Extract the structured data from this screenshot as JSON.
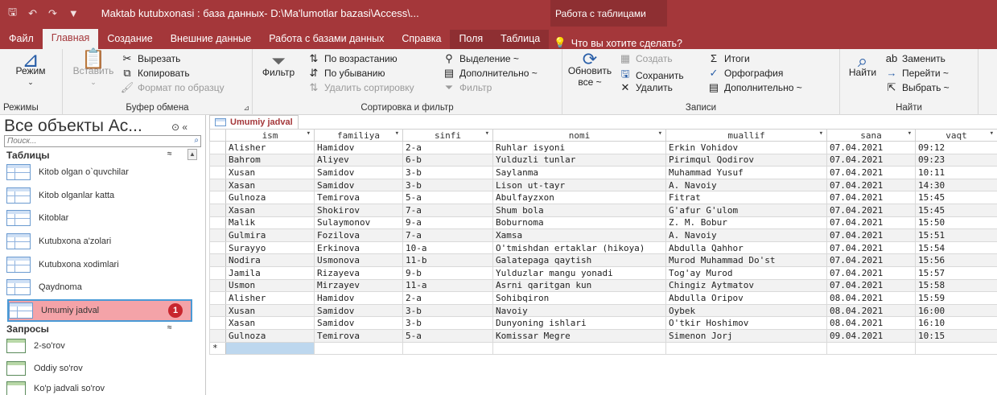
{
  "titlebar": {
    "quick_access": [
      "🖫",
      "↶",
      "↷",
      "▼"
    ],
    "title": "Maktab kutubxonasi : база данных- D:\\Ma'lumotlar bazasi\\Access\\...",
    "context_title": "Работа с таблицами"
  },
  "menubar": {
    "tabs": [
      "Файл",
      "Главная",
      "Создание",
      "Внешние данные",
      "Работа с базами данных",
      "Справка",
      "Поля",
      "Таблица"
    ],
    "tell_me": "Что вы хотите сделать?"
  },
  "ribbon": {
    "modes": {
      "button": "Режим",
      "label": "Режимы"
    },
    "clipboard": {
      "paste": "Вставить",
      "cut": "Вырезать",
      "copy": "Копировать",
      "format_painter": "Формат по образцу",
      "label": "Буфер обмена"
    },
    "sort": {
      "filter": "Фильтр",
      "ascending": "По возрастанию",
      "descending": "По убыванию",
      "remove_sort": "Удалить сортировку",
      "selection": "Выделение ~",
      "advanced": "Дополнительно ~",
      "toggle_filter": "Фильтр",
      "label": "Сортировка и фильтр"
    },
    "records": {
      "refresh": "Обновить все ~",
      "new": "Создать",
      "save": "Сохранить",
      "delete": "Удалить",
      "totals": "Итоги",
      "spelling": "Орфография",
      "more": "Дополнительно ~",
      "label": "Записи"
    },
    "find": {
      "find": "Найти",
      "replace": "Заменить",
      "goto": "Перейти ~",
      "select": "Выбрать ~",
      "label": "Найти"
    }
  },
  "nav": {
    "title": "Все объекты Ac...",
    "search_placeholder": "Поиск...",
    "tables_header": "Таблицы",
    "tables": [
      "Kitob olgan o`quvchilar",
      "Kitob olganlar katta",
      "Kitoblar",
      "Kutubxona a'zolari",
      "Kutubxona xodimlari",
      "Qaydnoma",
      "Umumiy jadval"
    ],
    "selected_badge": "1",
    "queries_header": "Запросы",
    "queries": [
      "2-so'rov",
      "Oddiy so'rov",
      "Ko'p jadvali so'rov"
    ]
  },
  "datasheet": {
    "tab_label": "Umumiy jadval",
    "columns": [
      "ism",
      "familiya",
      "sinfi",
      "nomi",
      "muallif",
      "sana",
      "vaqt"
    ],
    "rows": [
      [
        "Alisher",
        "Hamidov",
        "2-a",
        "Ruhlar isyoni",
        "Erkin Vohidov",
        "07.04.2021",
        "09:12"
      ],
      [
        "Bahrom",
        "Aliyev",
        "6-b",
        "Yulduzli tunlar",
        "Pirimqul Qodirov",
        "07.04.2021",
        "09:23"
      ],
      [
        "Xusan",
        "Samidov",
        "3-b",
        "Saylanma",
        "Muhammad Yusuf",
        "07.04.2021",
        "10:11"
      ],
      [
        "Xasan",
        "Samidov",
        "3-b",
        "Lison ut-tayr",
        "A. Navoiy",
        "07.04.2021",
        "14:30"
      ],
      [
        "Gulnoza",
        "Temirova",
        "5-a",
        "Abulfayzxon",
        "Fitrat",
        "07.04.2021",
        "15:45"
      ],
      [
        "Xasan",
        "Shokirov",
        "7-a",
        "Shum bola",
        "G'afur G'ulom",
        "07.04.2021",
        "15:45"
      ],
      [
        "Malik",
        "Sulaymonov",
        "9-a",
        "Boburnoma",
        "Z. M. Bobur",
        "07.04.2021",
        "15:50"
      ],
      [
        "Gulmira",
        "Fozilova",
        "7-a",
        "Xamsa",
        "A. Navoiy",
        "07.04.2021",
        "15:51"
      ],
      [
        "Surayyo",
        "Erkinova",
        "10-a",
        "O'tmishdan ertaklar (hikoya)",
        "Abdulla Qahhor",
        "07.04.2021",
        "15:54"
      ],
      [
        "Nodira",
        "Usmonova",
        "11-b",
        "Galatepaga qaytish",
        "Murod Muhammad Do'st",
        "07.04.2021",
        "15:56"
      ],
      [
        "Jamila",
        "Rizayeva",
        "9-b",
        "Yulduzlar mangu yonadi",
        "Tog'ay Murod",
        "07.04.2021",
        "15:57"
      ],
      [
        "Usmon",
        "Mirzayev",
        "11-a",
        "Asrni qaritgan kun",
        "Chingiz Aytmatov",
        "07.04.2021",
        "15:58"
      ],
      [
        "Alisher",
        "Hamidov",
        "2-a",
        "Sohibqiron",
        "Abdulla Oripov",
        "08.04.2021",
        "15:59"
      ],
      [
        "Xusan",
        "Samidov",
        "3-b",
        "Navoiy",
        "Oybek",
        "08.04.2021",
        "16:00"
      ],
      [
        "Xasan",
        "Samidov",
        "3-b",
        "Dunyoning ishlari",
        "O'tkir Hoshimov",
        "08.04.2021",
        "16:10"
      ],
      [
        "Gulnoza",
        "Temirova",
        "5-a",
        "Komissar Megre",
        "Simenon Jorj",
        "09.04.2021",
        "10:15"
      ]
    ],
    "new_row_marker": "*"
  },
  "colors": {
    "accent": "#a4373a",
    "selected_nav": "#f4a3a8",
    "badge": "#c8262e"
  }
}
